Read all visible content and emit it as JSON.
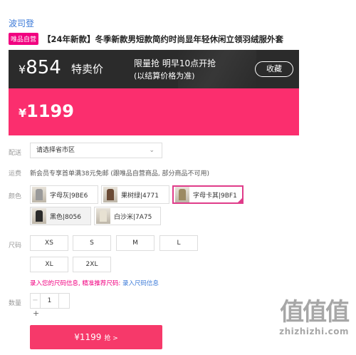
{
  "brand": "波司登",
  "product": {
    "tag": "唯品自营",
    "title": "【24年新款】冬季新款男短款简约时尚显年轻休闲立领羽绒服外套"
  },
  "price_banner": {
    "currency": "¥",
    "original_price": "854",
    "sale_label": "特卖价",
    "flash_label": "限量抢 明早10点开抢",
    "flash_note": "(以结算价格为准)",
    "favorite_label": "收藏",
    "current_price": "1199"
  },
  "delivery": {
    "label": "配送",
    "placeholder": "请选择省市区",
    "chevron_icon": "chevron-down-icon"
  },
  "shipping": {
    "label": "运费",
    "text": "新会员专享首单满38元免邮 (跟唯品自营商品, 部分商品不可用)"
  },
  "colors": {
    "label": "颜色",
    "options": [
      {
        "name": "字母灰|9BE6"
      },
      {
        "name": "果树绿|4771"
      },
      {
        "name": "字母卡其|9BF1"
      },
      {
        "name": "黑色|8056"
      },
      {
        "name": "白沙米|7A75"
      }
    ]
  },
  "sizes": {
    "label": "尺码",
    "options": [
      "XS",
      "S",
      "M",
      "L",
      "XL",
      "2XL"
    ]
  },
  "size_hint": {
    "pink_text": "录入您的尺码信息, 精准推荐尺码:",
    "link_text": "录入尺码信息"
  },
  "quantity": {
    "label": "数量",
    "minus": "−",
    "value": "1",
    "plus": "+"
  },
  "buy_button": {
    "label": "¥1199",
    "suffix": "抢 >"
  },
  "watermark": {
    "big": "值值值",
    "small": "zhizhizhi.com"
  }
}
